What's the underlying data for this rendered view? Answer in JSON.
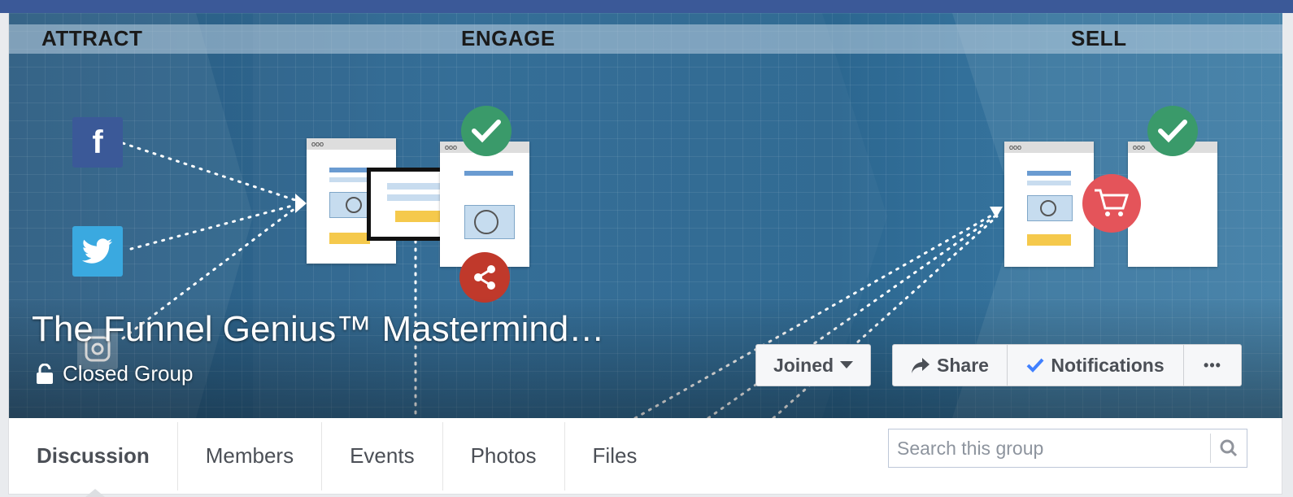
{
  "group": {
    "title": "The Funnel Genius™ Mastermind…",
    "privacy": "Closed Group"
  },
  "cover": {
    "stages": [
      "ATTRACT",
      "ENGAGE",
      "SELL"
    ],
    "social_icons": [
      "facebook-icon",
      "twitter-icon",
      "instagram-icon"
    ],
    "window_label": "ooo"
  },
  "actions": {
    "joined": "Joined",
    "share": "Share",
    "notifications": "Notifications",
    "more": "•••"
  },
  "tabs": [
    {
      "label": "Discussion",
      "active": true
    },
    {
      "label": "Members",
      "active": false
    },
    {
      "label": "Events",
      "active": false
    },
    {
      "label": "Photos",
      "active": false
    },
    {
      "label": "Files",
      "active": false
    }
  ],
  "search": {
    "placeholder": "Search this group"
  },
  "colors": {
    "facebook_blue": "#3b5998",
    "check_green": "#3a9a6a",
    "share_red": "#c0392b",
    "cart_red": "#e4545a",
    "notify_check": "#4080ff"
  }
}
